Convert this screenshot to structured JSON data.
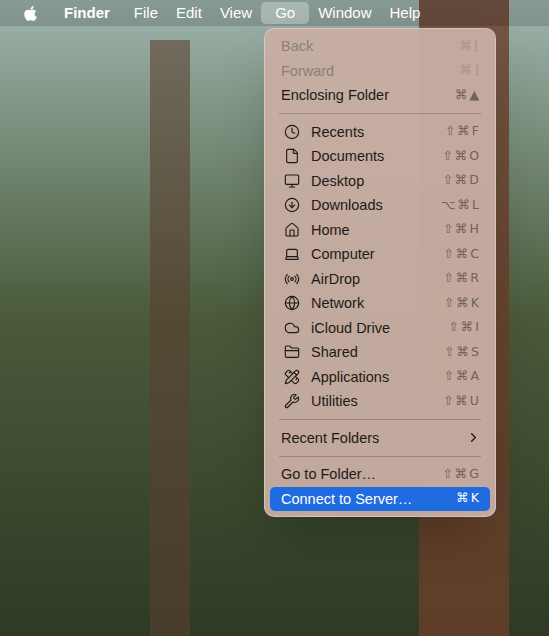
{
  "menu_bar": {
    "items": [
      {
        "label": "Finder",
        "kind": "app",
        "selected": false
      },
      {
        "label": "File",
        "kind": "menu",
        "selected": false
      },
      {
        "label": "Edit",
        "kind": "menu",
        "selected": false
      },
      {
        "label": "View",
        "kind": "menu",
        "selected": false
      },
      {
        "label": "Go",
        "kind": "menu",
        "selected": true
      },
      {
        "label": "Window",
        "kind": "menu",
        "selected": false
      },
      {
        "label": "Help",
        "kind": "menu",
        "selected": false
      }
    ]
  },
  "menu": {
    "sections": [
      [
        {
          "label": "Back",
          "shortcut": "⌘[",
          "kind": "command",
          "disabled": true,
          "selected": false
        },
        {
          "label": "Forward",
          "shortcut": "⌘]",
          "kind": "command",
          "disabled": true,
          "selected": false
        },
        {
          "label": "Enclosing Folder",
          "shortcut": "⌘▲",
          "kind": "command",
          "disabled": false,
          "selected": false
        }
      ],
      [
        {
          "label": "Recents",
          "shortcut": "⇧⌘F",
          "kind": "place",
          "disabled": false,
          "selected": false
        },
        {
          "label": "Documents",
          "shortcut": "⇧⌘O",
          "kind": "place",
          "disabled": false,
          "selected": false
        },
        {
          "label": "Desktop",
          "shortcut": "⇧⌘D",
          "kind": "place",
          "disabled": false,
          "selected": false
        },
        {
          "label": "Downloads",
          "shortcut": "⌥⌘L",
          "kind": "place",
          "disabled": false,
          "selected": false
        },
        {
          "label": "Home",
          "shortcut": "⇧⌘H",
          "kind": "place",
          "disabled": false,
          "selected": false
        },
        {
          "label": "Computer",
          "shortcut": "⇧⌘C",
          "kind": "place",
          "disabled": false,
          "selected": false
        },
        {
          "label": "AirDrop",
          "shortcut": "⇧⌘R",
          "kind": "place",
          "disabled": false,
          "selected": false
        },
        {
          "label": "Network",
          "shortcut": "⇧⌘K",
          "kind": "place",
          "disabled": false,
          "selected": false
        },
        {
          "label": "iCloud Drive",
          "shortcut": "⇧⌘I",
          "kind": "place",
          "disabled": false,
          "selected": false
        },
        {
          "label": "Shared",
          "shortcut": "⇧⌘S",
          "kind": "place",
          "disabled": false,
          "selected": false
        },
        {
          "label": "Applications",
          "shortcut": "⇧⌘A",
          "kind": "place",
          "disabled": false,
          "selected": false
        },
        {
          "label": "Utilities",
          "shortcut": "⇧⌘U",
          "kind": "place",
          "disabled": false,
          "selected": false
        }
      ],
      [
        {
          "label": "Recent Folders",
          "kind": "submenu",
          "disabled": false,
          "selected": false
        }
      ],
      [
        {
          "label": "Go to Folder…",
          "shortcut": "⇧⌘G",
          "kind": "command",
          "disabled": false,
          "selected": false
        },
        {
          "label": "Connect to Server…",
          "shortcut": "⌘K",
          "kind": "command",
          "disabled": false,
          "selected": true
        }
      ]
    ]
  }
}
